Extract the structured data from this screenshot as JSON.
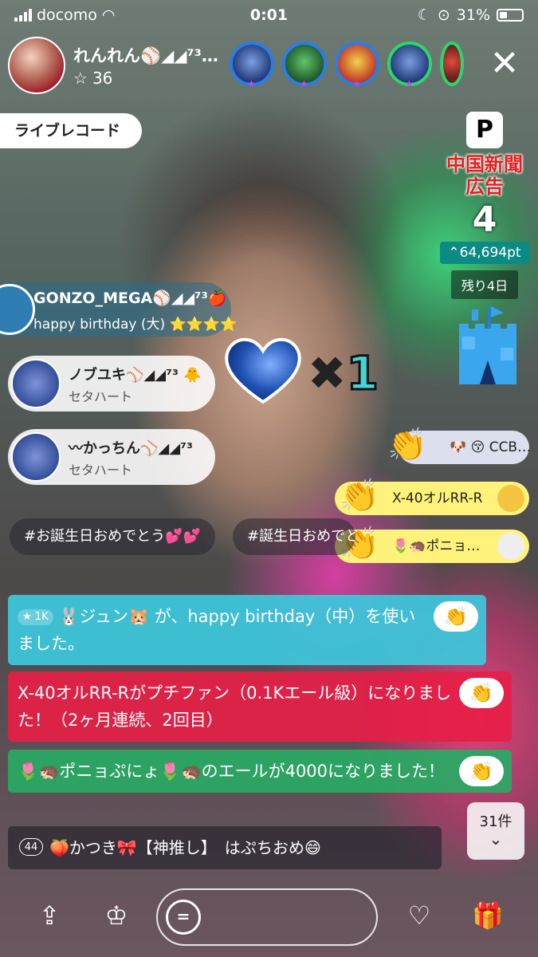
{
  "status_bar": {
    "carrier": "docomo",
    "time": "0:01",
    "battery": "31%"
  },
  "streamer": {
    "name": "れんれん⚾◢◢⁷³…",
    "star_count": "36"
  },
  "viewers": [
    "viewer-1",
    "viewer-2",
    "viewer-3",
    "viewer-4",
    "viewer-5"
  ],
  "live_record_label": "ライブレコード",
  "ad_event": {
    "logo": "P",
    "title": "中国新聞\n広告",
    "rank": "4",
    "points": "⌃64,694pt",
    "remaining": "残り4日"
  },
  "gift_notifications": [
    {
      "user": "GONZO_MEGA⚾◢◢⁷³🍎",
      "text": "happy birthday (大) ⭐⭐⭐⭐"
    },
    {
      "user": "ノブユキ⚾◢◢⁷³ 🐥",
      "text": "セタハート"
    },
    {
      "user": "〰かっちん⚾◢◢⁷³",
      "text": "セタハート"
    }
  ],
  "heart_gift": {
    "multiplier_x": "✖",
    "multiplier_num": "1"
  },
  "reaction_tags": [
    {
      "text": "🐶 😚 CCB…"
    },
    {
      "text": "X-40オルRR-R"
    },
    {
      "text": "🌷🦔ポニョ…"
    }
  ],
  "hashtags": [
    "#お誕生日おめでとう💕💕",
    "#誕生日おめでとう"
  ],
  "comments": [
    {
      "badge": "1K",
      "text": "🐰ジュン🐹 が、happy birthday（中）を使いました。"
    },
    {
      "text": "X-40オルRR-Rがプチファン（0.1Kエール級）になりました！（2ヶ月連続、2回目）"
    },
    {
      "text": "🌷🦔ポニョぷにょ🌷🦔のエールが4000になりました！"
    }
  ],
  "last_comment": {
    "count": "44",
    "text": "🍑かつき🎀【神推し】　はぷちおめ😄"
  },
  "more_comments": "31件",
  "colors": {
    "accent_teal": "#3cc8dc",
    "alert_red": "#e61e46",
    "success_green": "#28aa64",
    "ad_red": "#e02020"
  }
}
